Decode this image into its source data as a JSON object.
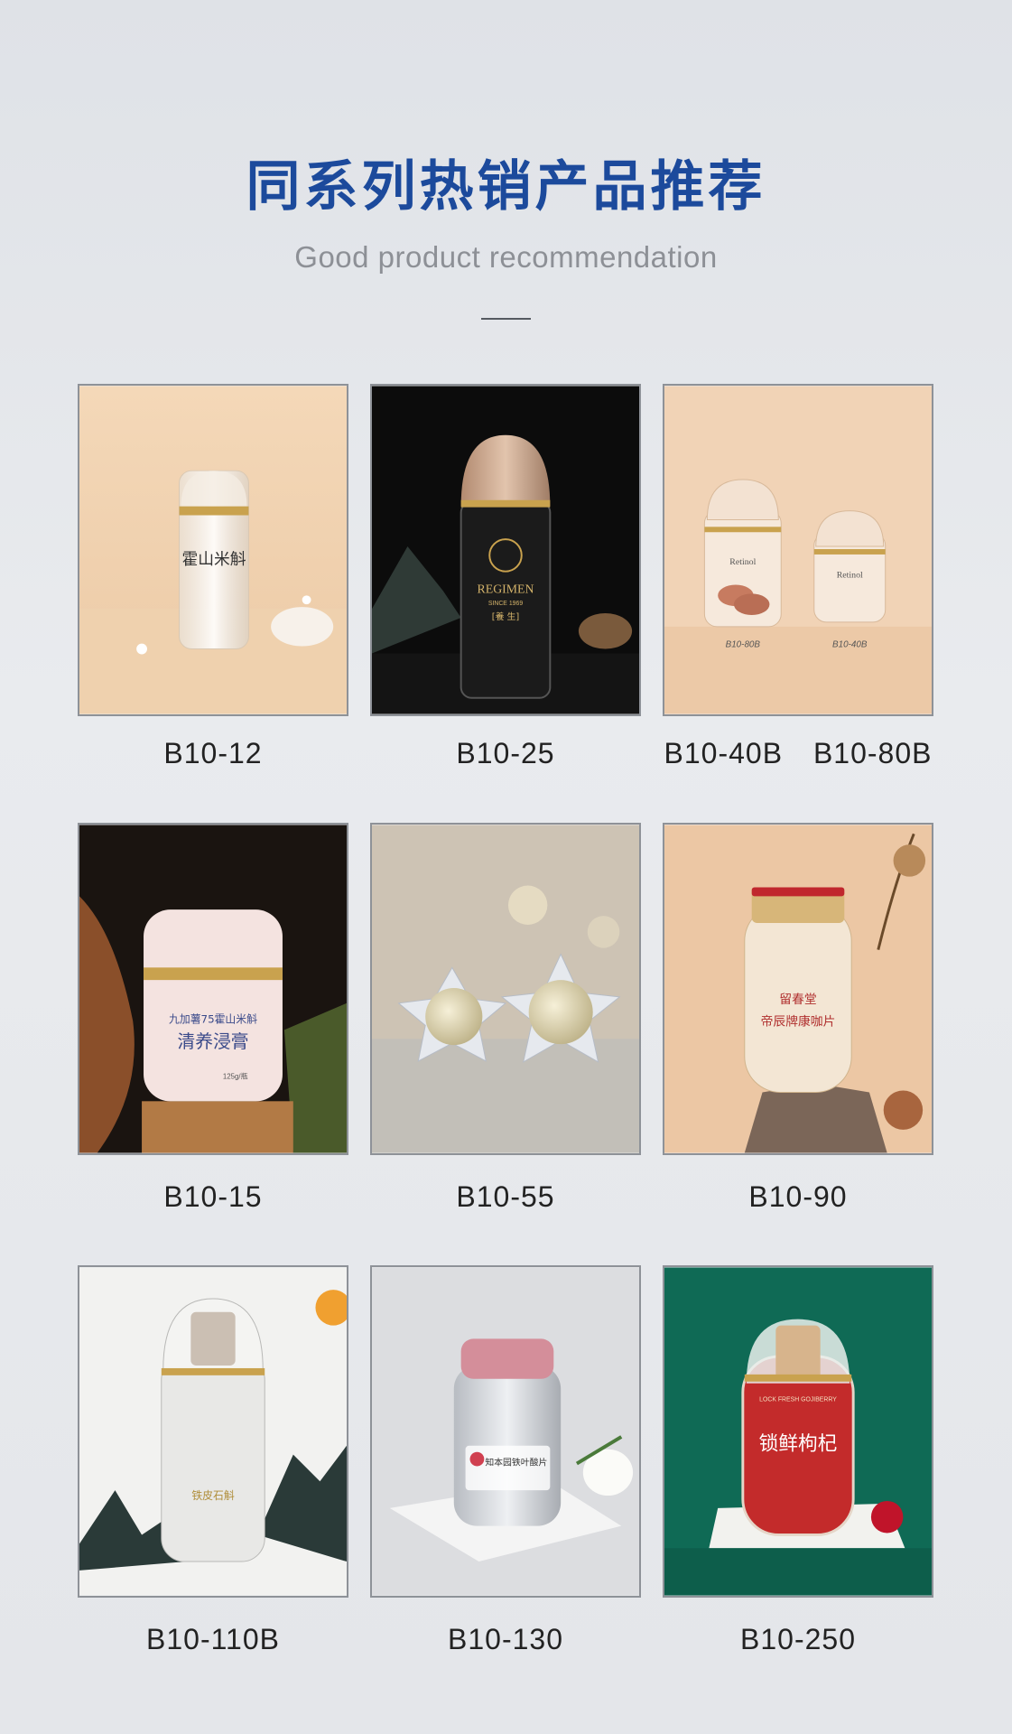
{
  "header": {
    "title": "同系列热销产品推荐",
    "subtitle": "Good product recommendation"
  },
  "products": [
    {
      "code": "B10-12",
      "bottle_text": "霍山米斛"
    },
    {
      "code": "B10-25",
      "bottle_text": "REGIMEN",
      "bottle_sub": "SINCE 1969",
      "bottle_cn": "[養 生]"
    },
    {
      "code": "B10-40B   B10-80B",
      "bottle_text": "Retinol",
      "bottle_left": "B10-80B",
      "bottle_right": "B10-40B"
    },
    {
      "code": "B10-15",
      "bottle_text": "清养浸膏",
      "bottle_sub": "九加薯75霍山米斛",
      "bottle_weight": "125g/瓶"
    },
    {
      "code": "B10-55"
    },
    {
      "code": "B10-90",
      "bottle_brand": "留春堂",
      "bottle_text": "帝辰牌康咖片"
    },
    {
      "code": "B10-110B",
      "bottle_text": "铁皮石斛"
    },
    {
      "code": "B10-130",
      "bottle_text": "知本园铁叶酸片"
    },
    {
      "code": "B10-250",
      "bottle_text": "锁鲜枸杞",
      "bottle_sub": "LOCK FRESH GOJIBERRY"
    }
  ],
  "colors": {
    "title": "#1c4a9c",
    "subtitle": "#8d9096",
    "border": "#8e9298"
  }
}
